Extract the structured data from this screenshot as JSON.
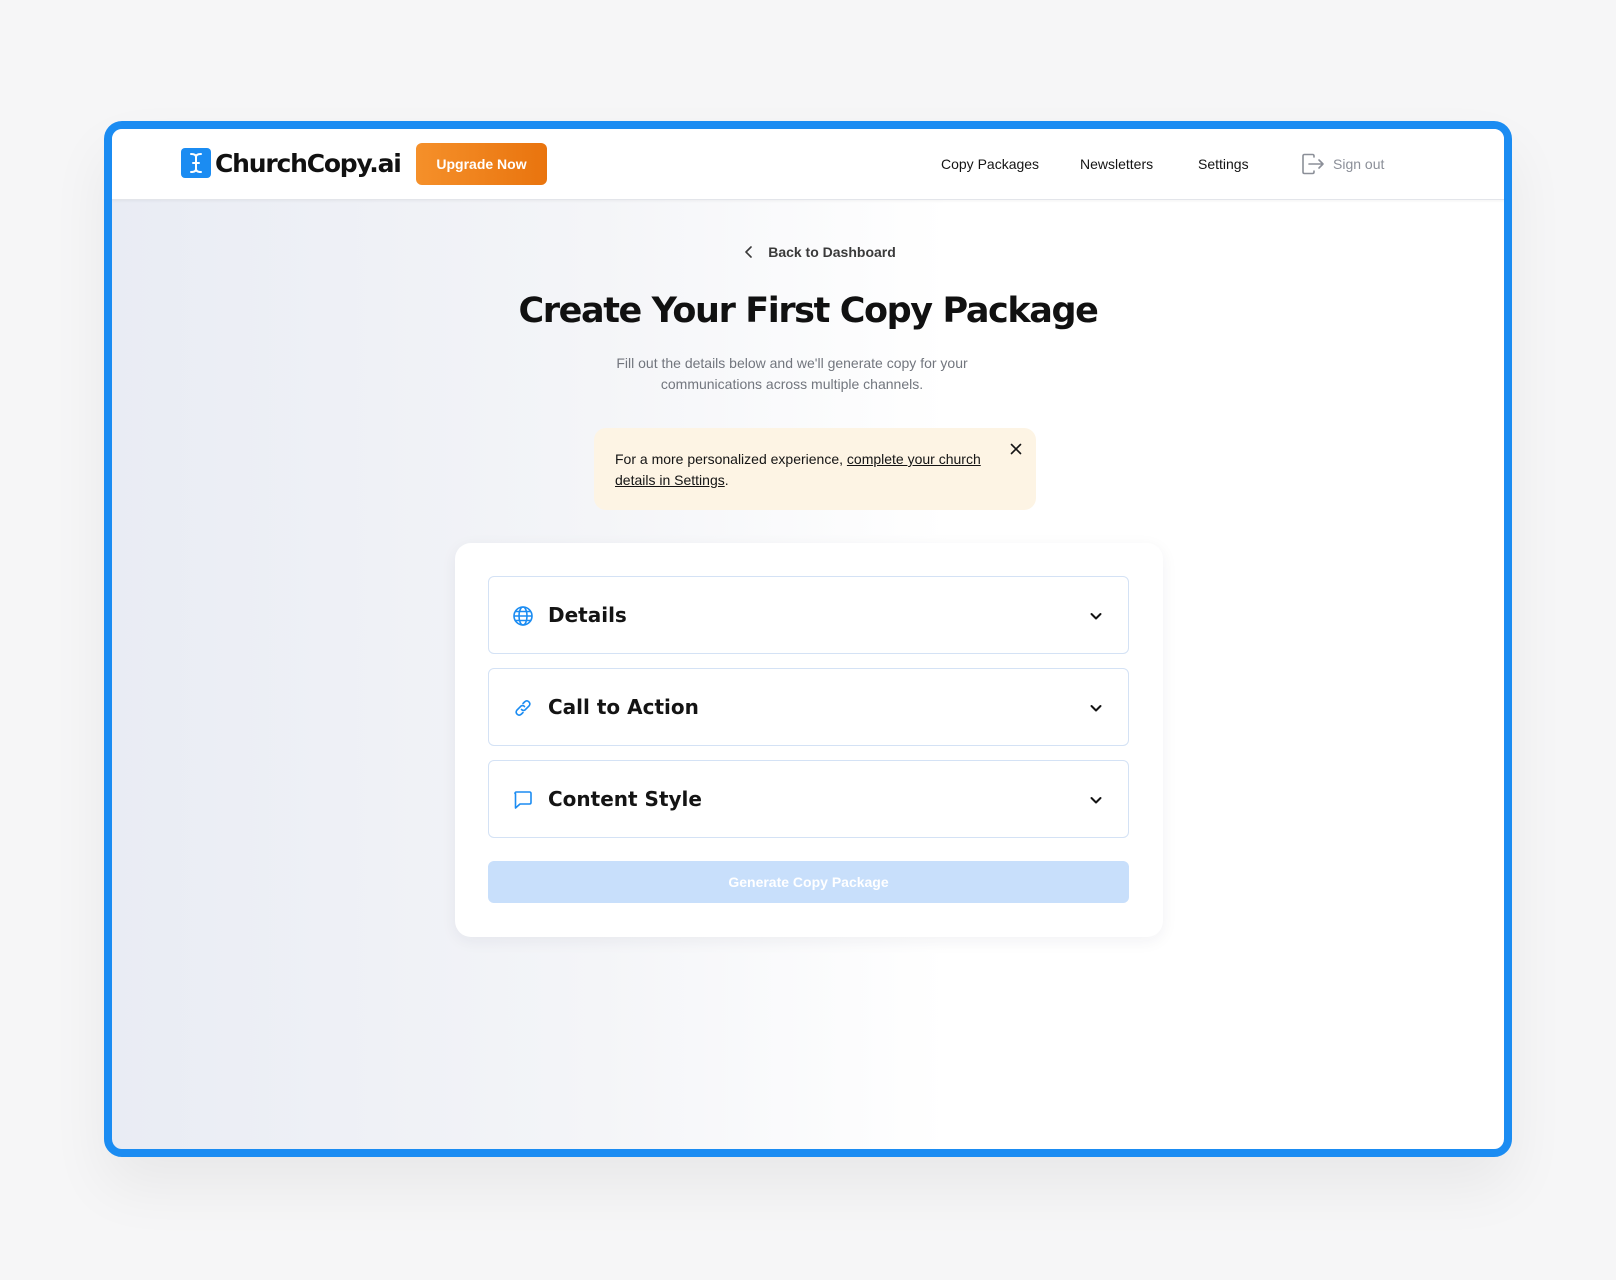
{
  "brand": {
    "name": "ChurchCopy.ai",
    "accent": "#1b8cf2",
    "upgrade_color": "#f0851d"
  },
  "header": {
    "upgrade_label": "Upgrade Now",
    "nav": [
      "Copy Packages",
      "Newsletters",
      "Settings"
    ],
    "signout_label": "Sign out"
  },
  "page": {
    "back_label": "Back to Dashboard",
    "title": "Create Your First Copy Package",
    "subtitle": "Fill out the details below and we'll generate copy for your communications across multiple channels."
  },
  "notice": {
    "text_before": "For a more personalized experience, ",
    "link_text": "complete your church details in Settings",
    "text_after": "."
  },
  "form": {
    "sections": [
      {
        "label": "Details",
        "icon": "globe-icon"
      },
      {
        "label": "Call to Action",
        "icon": "link-icon"
      },
      {
        "label": "Content Style",
        "icon": "chat-bubble-icon"
      }
    ],
    "generate_label": "Generate Copy Package"
  }
}
